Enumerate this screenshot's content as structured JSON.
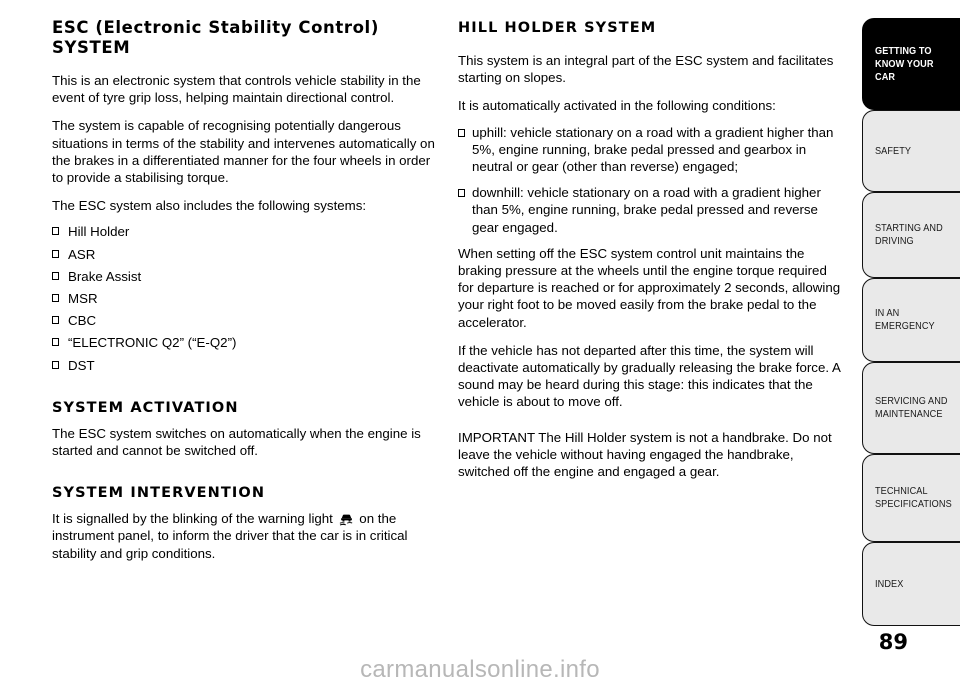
{
  "page": {
    "number": "89",
    "watermark": "carmanualsonline.info"
  },
  "left_column": {
    "heading": "ESC (Electronic Stability Control) SYSTEM",
    "paragraphs": [
      "This is an electronic system that controls vehicle stability in the event of tyre grip loss, helping maintain directional control.",
      "The system is capable of recognising potentially dangerous situations in terms of the stability and intervenes automatically on the brakes in a differentiated manner for the four wheels in order to provide a stabilising torque.",
      "The ESC system also includes the following systems:"
    ],
    "list": [
      "Hill Holder",
      "ASR",
      "Brake Assist",
      "MSR",
      "CBC",
      "“ELECTRONIC Q2” (“E-Q2”)",
      "DST"
    ],
    "activation": {
      "heading": "SYSTEM ACTIVATION",
      "text": "The ESC system switches on automatically when the engine is started and cannot be switched off."
    },
    "intervention": {
      "heading": "SYSTEM INTERVENTION",
      "text_before_icon": "It is signalled by the blinking of the warning light",
      "icon_name": "esc-skidding-car-warning-light",
      "text_after_icon": "on the instrument panel, to inform the driver that the car is in critical stability and grip conditions."
    }
  },
  "right_column": {
    "heading": "HILL HOLDER SYSTEM",
    "paragraphs_top": [
      "This system is an integral part of the ESC system and facilitates starting on slopes.",
      "It is automatically activated in the following conditions:"
    ],
    "conditions": [
      "uphill: vehicle stationary on a road with a gradient higher than 5%, engine running, brake pedal pressed and gearbox in neutral or gear (other than reverse) engaged;",
      "downhill: vehicle stationary on a road with a gradient higher than 5%, engine running, brake pedal pressed and reverse gear engaged."
    ],
    "paragraphs_bottom": [
      "When setting off the ESC system control unit maintains the braking pressure at the wheels until the engine torque required for departure is reached or for approximately 2 seconds, allowing your right foot to be moved easily from the brake pedal to the accelerator.",
      "If the vehicle has not departed after this time, the system will deactivate automatically by gradually releasing the brake force. A sound may be heard during this stage: this indicates that the vehicle is about to move off."
    ],
    "important": "IMPORTANT The Hill Holder system is not a handbrake. Do not leave the vehicle without having engaged the handbrake, switched off the engine and engaged a gear."
  },
  "tabs": [
    {
      "label": "GETTING TO KNOW YOUR CAR",
      "active": true
    },
    {
      "label": "SAFETY",
      "active": false
    },
    {
      "label": "STARTING AND DRIVING",
      "active": false
    },
    {
      "label": "IN AN EMERGENCY",
      "active": false
    },
    {
      "label": "SERVICING AND MAINTENANCE",
      "active": false
    },
    {
      "label": "TECHNICAL SPECIFICATIONS",
      "active": false
    },
    {
      "label": "INDEX",
      "active": false
    }
  ],
  "colors": {
    "active_tab_bg": "#000000",
    "inactive_tab_bg": "#e9e9e9",
    "tab_border": "#111111",
    "watermark": "#b7b7b7"
  }
}
